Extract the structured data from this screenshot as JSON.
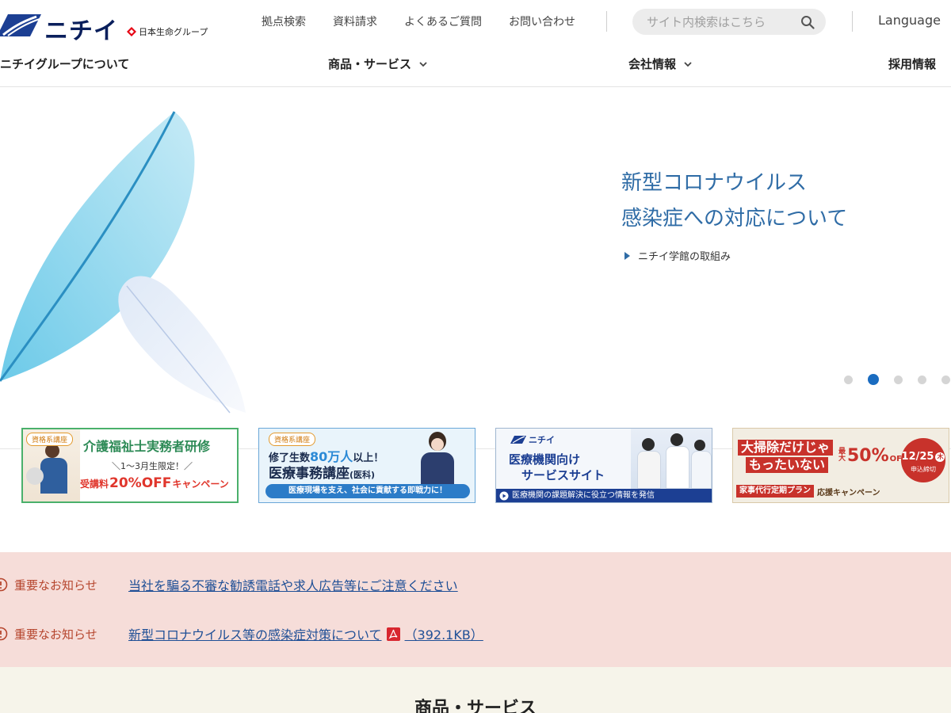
{
  "header": {
    "logo_text": "ニチイ",
    "group_text": "日本生命グループ",
    "utility_links": [
      "拠点検索",
      "資料請求",
      "よくあるご質問",
      "お問い合わせ"
    ],
    "search_placeholder": "サイト内検索はこちら",
    "language": "Language"
  },
  "main_nav": {
    "about": "ニチイグループについて",
    "products": "商品・サービス",
    "company": "会社情報",
    "recruit": "採用情報"
  },
  "hero": {
    "title_line1": "新型コロナウイルス",
    "title_line2": "感染症への対応について",
    "link": "ニチイ学館の取組み",
    "slide_count": 5,
    "active_slide": 2
  },
  "banners": [
    {
      "tag": "資格系講座",
      "title": "介護福祉士実務者研修",
      "sub": "＼1〜3月生限定！／",
      "cta_prefix": "受講料",
      "cta_big": "20%OFF",
      "cta_suffix": "キャンペーン"
    },
    {
      "tag": "資格系講座",
      "line1_a": "修了生数",
      "line1_num": "80万人",
      "line1_b": "以上！",
      "title": "医療事務講座",
      "title_note": "(医科)",
      "footer": "医療現場を支え、社会に貢献する即戦力に！"
    },
    {
      "logo": "ニチイ",
      "line1": "医療機関向け",
      "line2": "サービスサイト",
      "footer": "医療機関の課題解決に役立つ情報を発信"
    },
    {
      "line1": "大掃除だけじゃ",
      "line2": "もったいない",
      "max": "最大",
      "off": "50%",
      "off_suffix": "OFF",
      "date": "12/25",
      "weekday": "木",
      "deadline": "申込締切",
      "plan": "家事代行定期プラン",
      "campaign": "応援キャンペーン"
    }
  ],
  "notices": [
    {
      "label": "重要なお知らせ",
      "text": "当社を騙る不審な勧誘電話や求人広告等にご注意ください"
    },
    {
      "label": "重要なお知らせ",
      "text": "新型コロナウイルス等の感染症対策について",
      "size": "（392.1KB）"
    }
  ],
  "products": {
    "title": "商品・サービス"
  },
  "colors": {
    "accent": "#1a6cc0",
    "hero_text": "#2f6ca6",
    "notice_bg": "#f6ddd9",
    "notice_label": "#b5442c",
    "link": "#1f4f96"
  }
}
